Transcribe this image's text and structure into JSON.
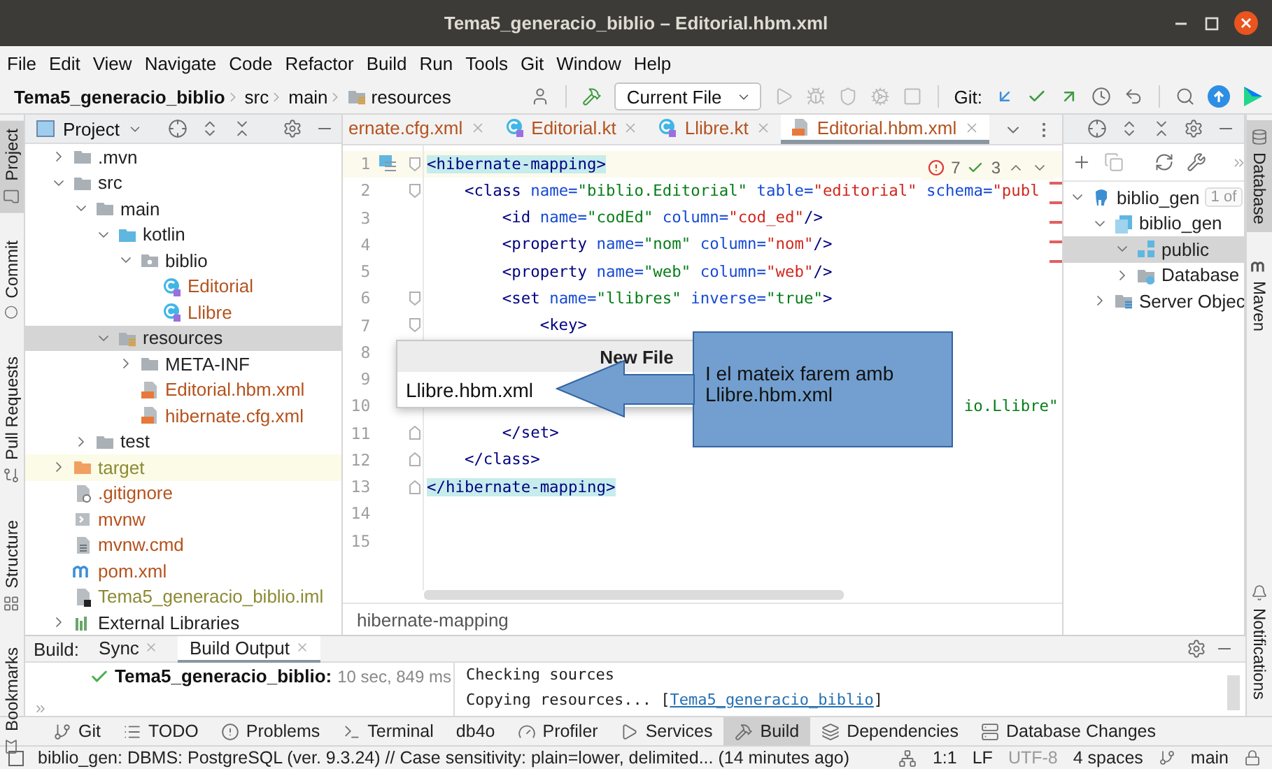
{
  "window": {
    "title": "Tema5_generacio_biblio – Editorial.hbm.xml"
  },
  "menu": [
    "File",
    "Edit",
    "View",
    "Navigate",
    "Code",
    "Refactor",
    "Build",
    "Run",
    "Tools",
    "Git",
    "Window",
    "Help"
  ],
  "breadcrumbs": [
    {
      "label": "Tema5_generacio_biblio",
      "kind": "project"
    },
    {
      "label": "src",
      "kind": "dir"
    },
    {
      "label": "main",
      "kind": "dir"
    },
    {
      "label": "resources",
      "kind": "resources"
    }
  ],
  "run_config": {
    "label": "Current File"
  },
  "git_label": "Git:",
  "left_stripe": [
    {
      "label": "Project",
      "kind": "project",
      "selected": true
    },
    {
      "label": "Commit",
      "kind": "commit",
      "selected": false
    },
    {
      "label": "Pull Requests",
      "kind": "pull-requests",
      "selected": false
    },
    {
      "label": "Structure",
      "kind": "structure",
      "selected": false
    },
    {
      "label": "Bookmarks",
      "kind": "bookmarks",
      "selected": false
    }
  ],
  "right_stripe": [
    {
      "label": "Database",
      "kind": "database",
      "selected": true
    },
    {
      "label": "Maven",
      "kind": "maven",
      "selected": false
    },
    {
      "label": "Notifications",
      "kind": "notifications",
      "selected": false
    }
  ],
  "project_panel": {
    "title": "Project",
    "tree": [
      {
        "label": ".mvn",
        "kind": "folder",
        "color": "#222222",
        "selected": false,
        "highlighted": false,
        "expanded": false
      },
      {
        "label": "src",
        "kind": "folder",
        "color": "#222222",
        "selected": false,
        "highlighted": false,
        "expanded": true,
        "children": [
          {
            "label": "main",
            "kind": "folder",
            "color": "#222222",
            "selected": false,
            "highlighted": false,
            "expanded": true,
            "children": [
              {
                "label": "kotlin",
                "kind": "source-folder",
                "color": "#222222",
                "selected": false,
                "highlighted": false,
                "expanded": true,
                "children": [
                  {
                    "label": "biblio",
                    "kind": "package",
                    "color": "#222222",
                    "selected": false,
                    "highlighted": false,
                    "expanded": true,
                    "children": [
                      {
                        "label": "Editorial",
                        "kind": "kotlin-class",
                        "color": "#b5521d",
                        "selected": false,
                        "highlighted": false
                      },
                      {
                        "label": "Llibre",
                        "kind": "kotlin-class",
                        "color": "#b5521d",
                        "selected": false,
                        "highlighted": false
                      }
                    ]
                  }
                ]
              },
              {
                "label": "resources",
                "kind": "resources-folder",
                "color": "#222222",
                "selected": true,
                "highlighted": false,
                "expanded": true,
                "children": [
                  {
                    "label": "META-INF",
                    "kind": "folder",
                    "color": "#222222",
                    "selected": false,
                    "highlighted": false,
                    "expanded": false
                  },
                  {
                    "label": "Editorial.hbm.xml",
                    "kind": "xml-file",
                    "color": "#b5521d",
                    "selected": false,
                    "highlighted": false
                  },
                  {
                    "label": "hibernate.cfg.xml",
                    "kind": "xml-file",
                    "color": "#b5521d",
                    "selected": false,
                    "highlighted": false
                  }
                ]
              }
            ]
          },
          {
            "label": "test",
            "kind": "folder",
            "color": "#222222",
            "selected": false,
            "highlighted": false,
            "expanded": false
          }
        ]
      },
      {
        "label": "target",
        "kind": "excluded-folder",
        "color": "#8c8a33",
        "selected": false,
        "highlighted": true,
        "expanded": false
      },
      {
        "label": ".gitignore",
        "kind": "ignore-file",
        "color": "#b5521d",
        "selected": false,
        "highlighted": false
      },
      {
        "label": "mvnw",
        "kind": "script-file",
        "color": "#b5521d",
        "selected": false,
        "highlighted": false
      },
      {
        "label": "mvnw.cmd",
        "kind": "text-file",
        "color": "#b5521d",
        "selected": false,
        "highlighted": false
      },
      {
        "label": "pom.xml",
        "kind": "maven-file",
        "color": "#b5521d",
        "selected": false,
        "highlighted": false
      },
      {
        "label": "Tema5_generacio_biblio.iml",
        "kind": "module-file",
        "color": "#8c8a33",
        "selected": false,
        "highlighted": false
      },
      {
        "label": "External Libraries",
        "kind": "library",
        "color": "#222222",
        "selected": false,
        "highlighted": false,
        "expanded": false
      }
    ]
  },
  "editor": {
    "tabs": [
      {
        "label": "ernate.cfg.xml",
        "selected": false
      },
      {
        "label": "Editorial.kt",
        "kind": "kotlin",
        "selected": false
      },
      {
        "label": "Llibre.kt",
        "kind": "kotlin",
        "selected": false
      },
      {
        "label": "Editorial.hbm.xml",
        "kind": "xml",
        "selected": true
      }
    ],
    "inspections": {
      "errors": "7",
      "warnings": "3"
    },
    "lines": [
      {
        "number": "1",
        "current": true,
        "marker": true,
        "fold_start": true,
        "tokens": [
          {
            "t": "<hibernate-mapping>",
            "kind": "matched-tag"
          }
        ]
      },
      {
        "number": "2",
        "current": false,
        "fold_start": true,
        "tokens": [
          {
            "t": "    <class",
            "kind": "tag"
          },
          {
            "t": " name=",
            "kind": "attr"
          },
          {
            "t": "\"biblio.Editorial\"",
            "kind": "str"
          },
          {
            "t": " table=",
            "kind": "attr"
          },
          {
            "t": "\"editorial\"",
            "kind": "col"
          },
          {
            "t": " schema=",
            "kind": "attr"
          },
          {
            "t": "\"publ",
            "kind": "col"
          }
        ]
      },
      {
        "number": "3",
        "current": false,
        "tokens": [
          {
            "t": "        <id",
            "kind": "tag"
          },
          {
            "t": " name=",
            "kind": "attr"
          },
          {
            "t": "\"codEd\"",
            "kind": "str"
          },
          {
            "t": " column=",
            "kind": "attr"
          },
          {
            "t": "\"cod_ed\"",
            "kind": "col"
          },
          {
            "t": "/>",
            "kind": "tag"
          }
        ]
      },
      {
        "number": "4",
        "current": false,
        "tokens": [
          {
            "t": "        <property",
            "kind": "tag"
          },
          {
            "t": " name=",
            "kind": "attr"
          },
          {
            "t": "\"nom\"",
            "kind": "str"
          },
          {
            "t": " column=",
            "kind": "attr"
          },
          {
            "t": "\"nom\"",
            "kind": "col"
          },
          {
            "t": "/>",
            "kind": "tag"
          }
        ]
      },
      {
        "number": "5",
        "current": false,
        "tokens": [
          {
            "t": "        <property",
            "kind": "tag"
          },
          {
            "t": " name=",
            "kind": "attr"
          },
          {
            "t": "\"web\"",
            "kind": "str"
          },
          {
            "t": " column=",
            "kind": "attr"
          },
          {
            "t": "\"web\"",
            "kind": "col"
          },
          {
            "t": "/>",
            "kind": "tag"
          }
        ]
      },
      {
        "number": "6",
        "current": false,
        "fold_start": true,
        "tokens": [
          {
            "t": "        <set",
            "kind": "tag"
          },
          {
            "t": " name=",
            "kind": "attr"
          },
          {
            "t": "\"llibres\"",
            "kind": "str"
          },
          {
            "t": " inverse=",
            "kind": "attr"
          },
          {
            "t": "\"true\"",
            "kind": "str"
          },
          {
            "t": ">",
            "kind": "tag"
          }
        ]
      },
      {
        "number": "7",
        "current": false,
        "fold_start": true,
        "tokens": [
          {
            "t": "            <key>",
            "kind": "tag"
          }
        ]
      },
      {
        "number": "8",
        "current": false
      },
      {
        "number": "9",
        "current": false
      },
      {
        "number": "10",
        "current": false,
        "tokens": [
          {
            "t": "                                                         io.Llibre\"",
            "kind": "str"
          }
        ]
      },
      {
        "number": "11",
        "current": false,
        "fold_end": true,
        "tokens": [
          {
            "t": "        </set>",
            "kind": "tag"
          }
        ]
      },
      {
        "number": "12",
        "current": false,
        "fold_end": true,
        "tokens": [
          {
            "t": "    </class>",
            "kind": "tag"
          }
        ]
      },
      {
        "number": "13",
        "current": false,
        "fold_end": true,
        "tokens": [
          {
            "t": "</hibernate-mapping>",
            "kind": "matched-tag"
          }
        ]
      },
      {
        "number": "14",
        "current": false
      },
      {
        "number": "15",
        "current": false
      }
    ],
    "breadcrumb": "hibernate-mapping"
  },
  "new_file_popup": {
    "title": "New File",
    "value": "Llibre.hbm.xml"
  },
  "callout": {
    "text": "I el mateix farem amb Llibre.hbm.xml"
  },
  "database_panel": {
    "tree": [
      {
        "label": "biblio_gen",
        "kind": "datasource",
        "badge": "1 of",
        "selected": false,
        "expanded": true,
        "children": [
          {
            "label": "biblio_gen",
            "kind": "database",
            "selected": false,
            "expanded": true,
            "children": [
              {
                "label": "public",
                "kind": "schema",
                "selected": true,
                "expanded": true
              },
              {
                "label": "Database",
                "kind": "folder-db",
                "selected": false,
                "expanded": false
              }
            ]
          },
          {
            "label": "Server Objec",
            "kind": "server-objects",
            "selected": false,
            "expanded": false
          }
        ]
      }
    ]
  },
  "build_panel": {
    "label": "Build:",
    "tabs": [
      {
        "label": "Sync",
        "selected": false
      },
      {
        "label": "Build Output",
        "selected": true
      }
    ],
    "result": {
      "name": "Tema5_generacio_biblio:",
      "time": "10 sec, 849 ms",
      "success": true
    },
    "console": [
      {
        "text": "Checking sources"
      },
      {
        "text": "Copying resources... [",
        "link": "Tema5_generacio_biblio",
        "after": "]"
      }
    ]
  },
  "tool_windows": [
    {
      "label": "Git",
      "kind": "git",
      "selected": false
    },
    {
      "label": "TODO",
      "kind": "todo",
      "selected": false
    },
    {
      "label": "Problems",
      "kind": "problems",
      "selected": false
    },
    {
      "label": "Terminal",
      "kind": "terminal",
      "selected": false
    },
    {
      "label": "db4o",
      "kind": "plain",
      "selected": false
    },
    {
      "label": "Profiler",
      "kind": "profiler",
      "selected": false
    },
    {
      "label": "Services",
      "kind": "services",
      "selected": false
    },
    {
      "label": "Build",
      "kind": "build",
      "selected": true
    },
    {
      "label": "Dependencies",
      "kind": "dependencies",
      "selected": false
    },
    {
      "label": "Database Changes",
      "kind": "database-changes",
      "selected": false
    }
  ],
  "status_bar": {
    "message": "biblio_gen: DBMS: PostgreSQL (ver. 9.3.24) // Case sensitivity: plain=lower, delimited... (14 minutes ago)",
    "position": "1:1",
    "line_ending": "LF",
    "encoding": "UTF-8",
    "indent": "4 spaces",
    "branch": "main"
  }
}
